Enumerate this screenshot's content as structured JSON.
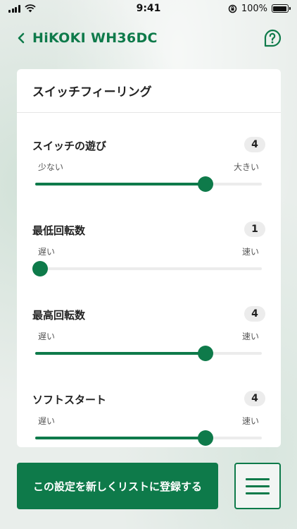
{
  "status_bar": {
    "time": "9:41",
    "battery": "100%",
    "icons": [
      "signal-icon",
      "wifi-icon",
      "orientation-lock-icon",
      "battery-icon"
    ]
  },
  "header": {
    "title": "HiKOKI WH36DC",
    "back_icon": "chevron-left-icon",
    "help_icon": "question-bubble-icon"
  },
  "card": {
    "title": "スイッチフィーリング",
    "settings": [
      {
        "label": "スイッチの遊び",
        "value": "4",
        "min_label": "少ない",
        "max_label": "大きい",
        "level": 0.75
      },
      {
        "label": "最低回転数",
        "value": "1",
        "min_label": "遅い",
        "max_label": "速い",
        "level": 0.0
      },
      {
        "label": "最高回転数",
        "value": "4",
        "min_label": "遅い",
        "max_label": "速い",
        "level": 0.75
      },
      {
        "label": "ソフトスタート",
        "value": "4",
        "min_label": "遅い",
        "max_label": "速い",
        "level": 0.75
      }
    ]
  },
  "footer": {
    "register_label": "この設定を新しくリストに登録する",
    "menu_icon": "hamburger-menu-icon"
  },
  "colors": {
    "accent": "#0e7a4a",
    "track": "#ececec",
    "badge": "#ececec"
  }
}
